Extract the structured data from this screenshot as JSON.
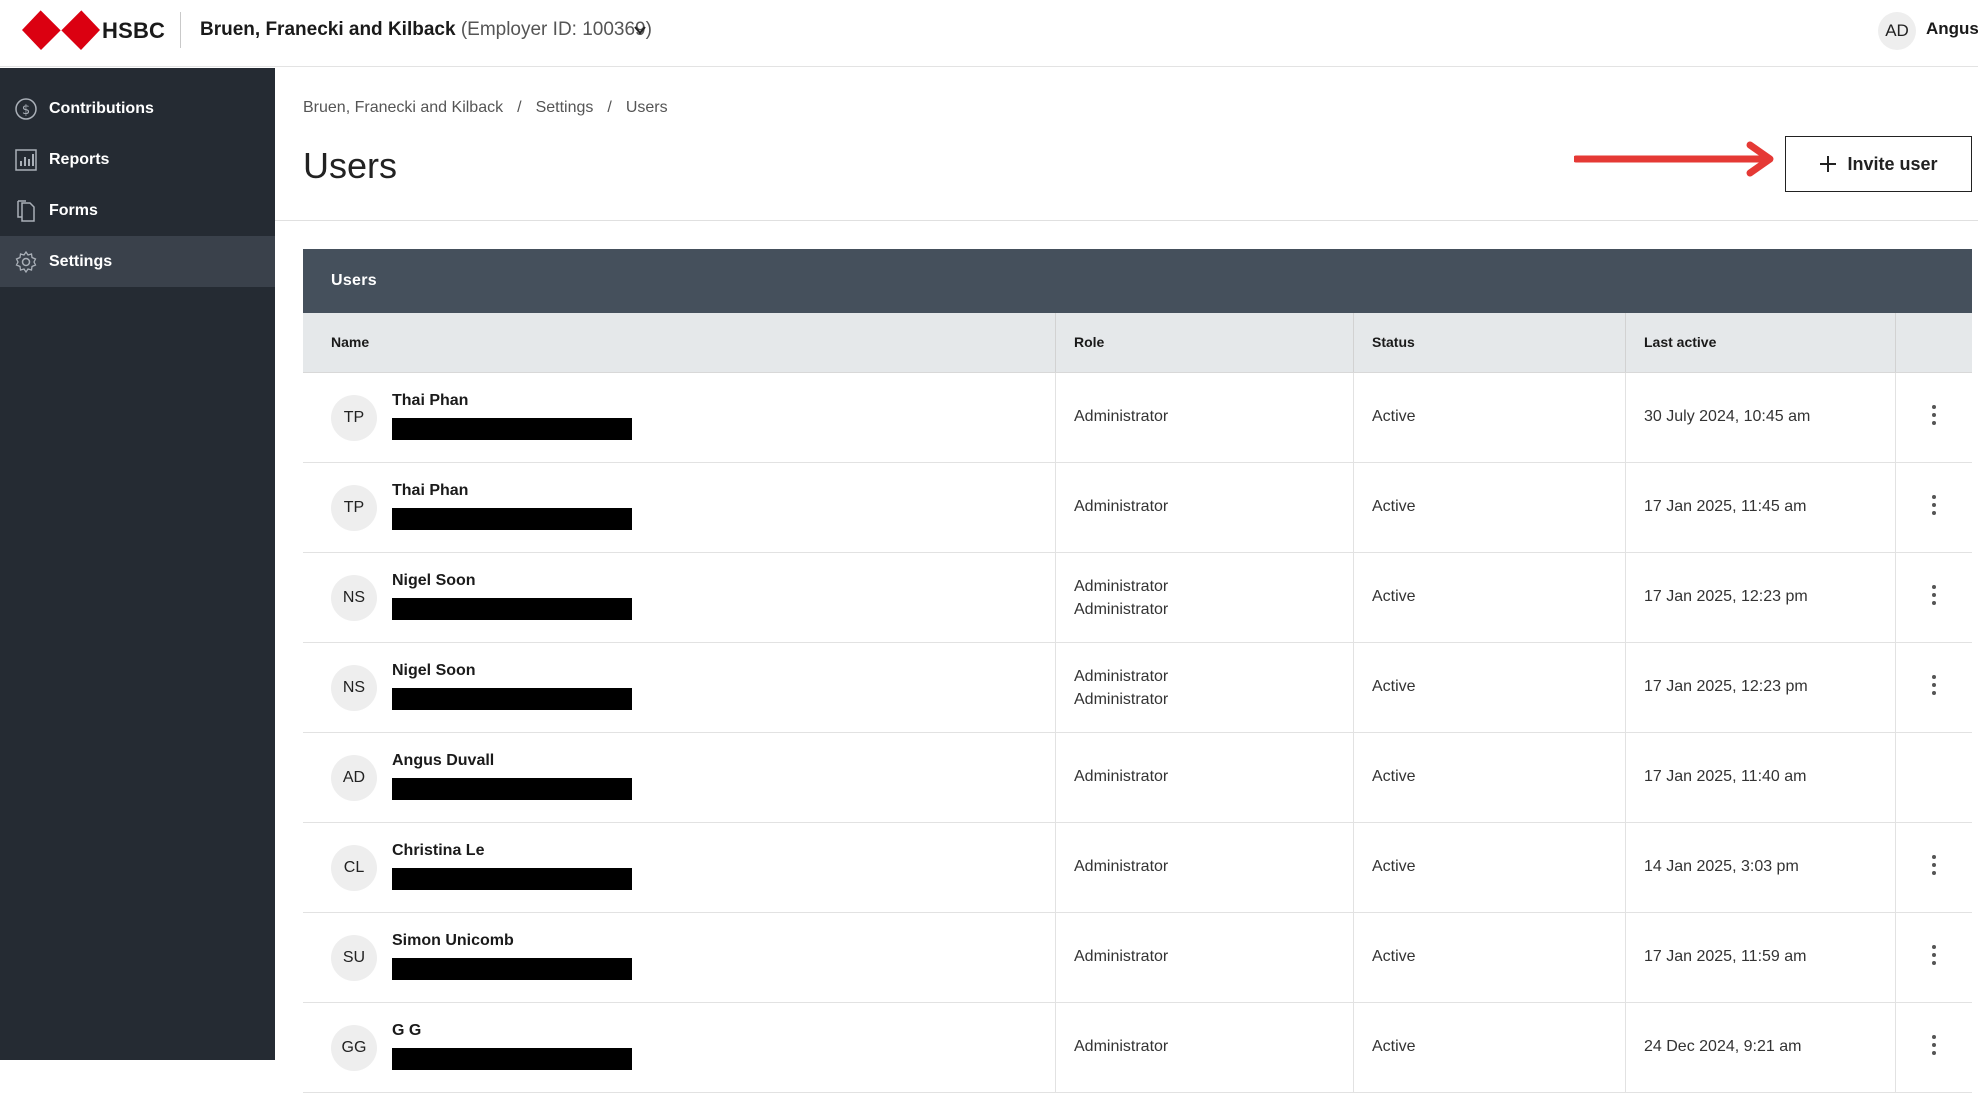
{
  "header": {
    "brand": "HSBC",
    "employer_name": "Bruen, Franecki and Kilback",
    "employer_id": "(Employer ID: 100369)",
    "user_initials": "AD",
    "user_name": "Angus"
  },
  "sidebar": {
    "items": [
      {
        "label": "Contributions",
        "icon": "dollar-circle-icon"
      },
      {
        "label": "Reports",
        "icon": "bar-chart-icon"
      },
      {
        "label": "Forms",
        "icon": "document-icon"
      },
      {
        "label": "Settings",
        "icon": "gear-icon"
      }
    ]
  },
  "breadcrumb": {
    "items": [
      "Bruen, Franecki and Kilback",
      "Settings",
      "Users"
    ],
    "separator": "/"
  },
  "page": {
    "title": "Users",
    "invite_label": "Invite user"
  },
  "table": {
    "title": "Users",
    "columns": [
      "Name",
      "Role",
      "Status",
      "Last active"
    ],
    "rows": [
      {
        "initials": "TP",
        "name": "Thai Phan",
        "roles": [
          "Administrator"
        ],
        "status": "Active",
        "last_active": "30 July 2024, 10:45 am",
        "menu": true
      },
      {
        "initials": "TP",
        "name": "Thai Phan",
        "roles": [
          "Administrator"
        ],
        "status": "Active",
        "last_active": "17 Jan 2025, 11:45 am",
        "menu": true
      },
      {
        "initials": "NS",
        "name": "Nigel Soon",
        "roles": [
          "Administrator",
          "Administrator"
        ],
        "status": "Active",
        "last_active": "17 Jan 2025, 12:23 pm",
        "menu": true
      },
      {
        "initials": "NS",
        "name": "Nigel Soon",
        "roles": [
          "Administrator",
          "Administrator"
        ],
        "status": "Active",
        "last_active": "17 Jan 2025, 12:23 pm",
        "menu": true
      },
      {
        "initials": "AD",
        "name": "Angus Duvall",
        "roles": [
          "Administrator"
        ],
        "status": "Active",
        "last_active": "17 Jan 2025, 11:40 am",
        "menu": false
      },
      {
        "initials": "CL",
        "name": "Christina Le",
        "roles": [
          "Administrator"
        ],
        "status": "Active",
        "last_active": "14 Jan 2025, 3:03 pm",
        "menu": true
      },
      {
        "initials": "SU",
        "name": "Simon Unicomb",
        "roles": [
          "Administrator"
        ],
        "status": "Active",
        "last_active": "17 Jan 2025, 11:59 am",
        "menu": true
      },
      {
        "initials": "GG",
        "name": "G G",
        "roles": [
          "Administrator"
        ],
        "status": "Active",
        "last_active": "24 Dec 2024, 9:21 am",
        "menu": true
      }
    ]
  },
  "colors": {
    "brand_red": "#db0011",
    "sidebar_bg": "#252b33",
    "sidebar_active": "#3a414b",
    "table_header": "#45505c",
    "annotation_arrow": "#e53935"
  }
}
